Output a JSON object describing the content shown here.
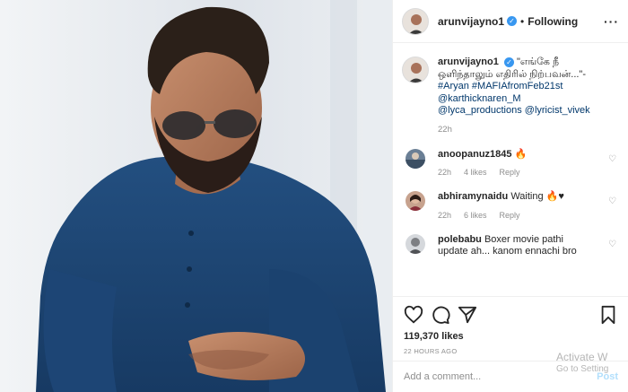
{
  "post": {
    "username": "arunvijayno1",
    "verified": true,
    "follow_status": "Following",
    "more_icon": "ellipsis-icon",
    "caption": {
      "text": "\"எங்கே நீ ஒளிந்தாலும் எதிரில் நிற்பவன்...\"- ",
      "hashtag1": "#Aryan",
      "hashtag2": "#MAFIAfromFeb21st",
      "mention1": "@karthicknaren_M",
      "mention2": "@lyca_productions",
      "mention3": "@lyricist_vivek",
      "time": "22h"
    },
    "comments": [
      {
        "username": "anoopanuz1845",
        "text": "🔥",
        "time": "22h",
        "likes": "4 likes",
        "reply": "Reply"
      },
      {
        "username": "abhiramynaidu",
        "text": "Waiting 🔥♥",
        "time": "22h",
        "likes": "6 likes",
        "reply": "Reply"
      },
      {
        "username": "polebabu",
        "text": "Boxer movie pathi update ah... kanom ennachi bro",
        "time": "",
        "likes": "",
        "reply": ""
      }
    ],
    "likes_count": "119,370 likes",
    "time_ago": "22 HOURS AGO",
    "add_comment_placeholder": "Add a comment...",
    "post_button": "Post"
  },
  "watermark": {
    "line1": "Activate W",
    "line2": "Go to Setting"
  },
  "colors": {
    "link": "#00376b",
    "verified": "#3897f0",
    "muted": "#8e8e8e",
    "shirt": "#1f4a7a"
  }
}
